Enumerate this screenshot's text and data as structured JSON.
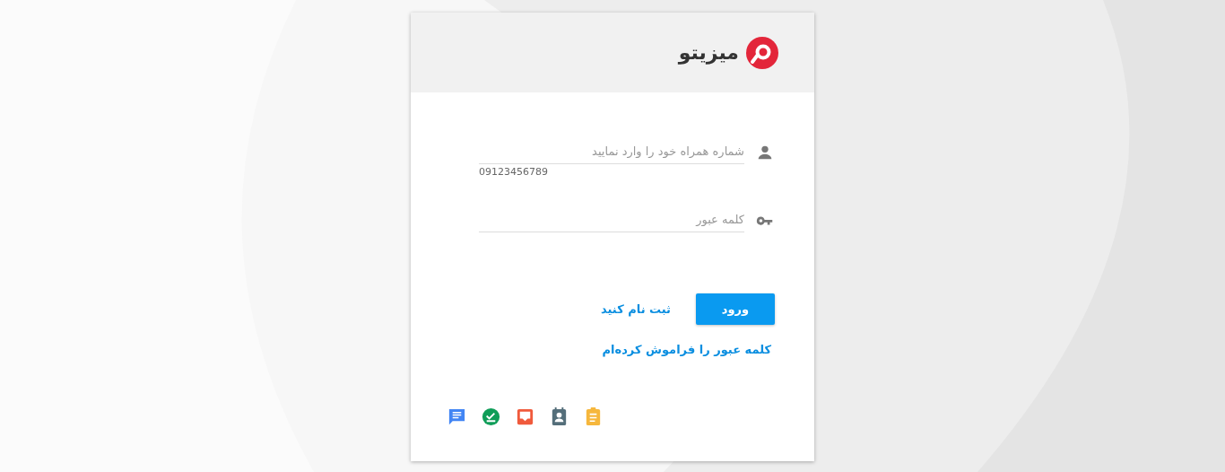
{
  "brand": {
    "name": "میزیتو"
  },
  "fields": [
    {
      "kind": "phone",
      "placeholder": "شماره همراه خود را وارد نمایید",
      "hint": "09123456789"
    },
    {
      "kind": "password",
      "placeholder": "کلمه عبور"
    }
  ],
  "login_button": "ورود",
  "register_link": "ثبت نام کنید",
  "forgot_link": "کلمه عبور را فراموش کرده‌ام",
  "apps": [
    {
      "kind": "chat",
      "color": "#4285f4"
    },
    {
      "kind": "check",
      "color": "#0f9d58"
    },
    {
      "kind": "inbox",
      "color": "#f05a3c"
    },
    {
      "kind": "contact",
      "color": "#546e7a"
    },
    {
      "kind": "clipboard",
      "color": "#f6b73c"
    }
  ]
}
